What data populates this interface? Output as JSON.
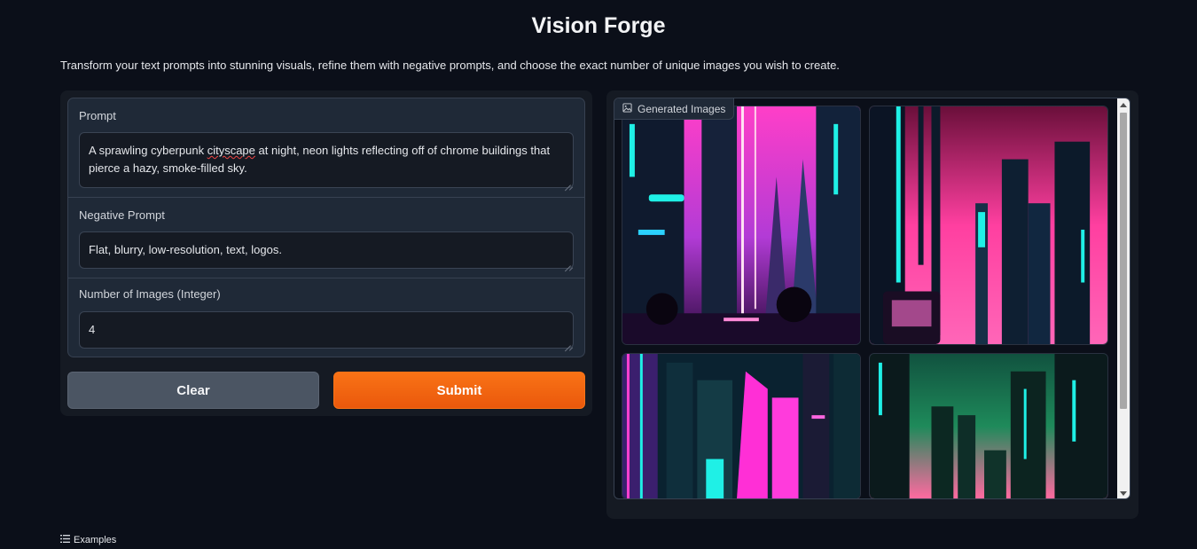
{
  "app": {
    "title": "Vision Forge",
    "description": "Transform your text prompts into stunning visuals, refine them with negative prompts, and choose the exact number of unique images you wish to create."
  },
  "form": {
    "prompt": {
      "label": "Prompt",
      "value_before": "A sprawling cyberpunk ",
      "value_misspelled": "cityscape",
      "value_after": " at night, neon lights reflecting off of chrome buildings that pierce a hazy, smoke-filled sky."
    },
    "negative_prompt": {
      "label": "Negative Prompt",
      "value": "Flat, blurry, low-resolution, text, logos."
    },
    "num_images": {
      "label": "Number of Images (Integer)",
      "value": "4"
    }
  },
  "buttons": {
    "clear": "Clear",
    "submit": "Submit"
  },
  "gallery": {
    "label": "Generated Images",
    "icon": "image-icon",
    "images": [
      "cyberpunk-city-1",
      "cyberpunk-city-2",
      "cyberpunk-city-3",
      "cyberpunk-city-4"
    ]
  },
  "examples": {
    "label": "Examples",
    "icon": "list-icon"
  },
  "colors": {
    "background": "#0b0f19",
    "panel": "#151a23",
    "accent": "#f97316",
    "neon_pink": "#ff3ec8",
    "neon_cyan": "#1ff0e6"
  }
}
